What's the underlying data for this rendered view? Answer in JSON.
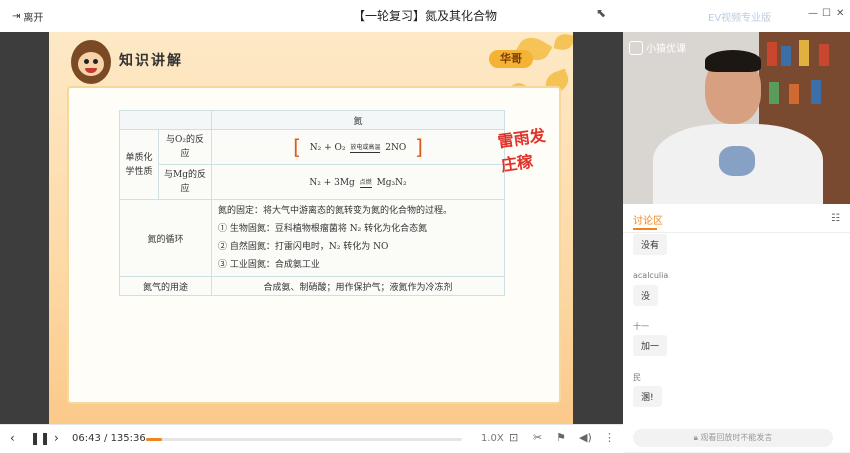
{
  "top_bar": {
    "leave_label": "离开",
    "title": "【一轮复习】氮及其化合物",
    "watermark": "EV视频专业版"
  },
  "slide": {
    "header_title": "知识讲解",
    "teacher_tag": "华哥",
    "table": {
      "header": "氮",
      "row1_label": "单质化学性质",
      "row1_sub1": "与O₂的反应",
      "row1_eq1": {
        "left": "N₂ + O₂",
        "cond": "放电或高温",
        "right": "2NO"
      },
      "row1_sub2": "与Mg的反应",
      "row1_eq2": {
        "left": "N₂ + 3Mg",
        "cond": "点燃",
        "right": "Mg₃N₂"
      },
      "row2_label": "氮的循环",
      "row2_lines": [
        "氮的固定：将大气中游离态的氮转变为氮的化合物的过程。",
        "① 生物固氮：豆科植物根瘤菌将 N₂ 转化为化合态氮",
        "② 自然固氮：打雷闪电时，N₂ 转化为 NO",
        "③ 工业固氮：合成氨工业"
      ],
      "row3_label": "氮气的用途",
      "row3_value": "合成氨、制硝酸；用作保护气；液氮作为冷冻剂"
    },
    "handwriting": "雷雨发庄稼"
  },
  "controls": {
    "time_current": "06:43",
    "time_sep": " / ",
    "time_total": "135:36",
    "progress": 0.05,
    "speed": "1.0X"
  },
  "video": {
    "brand": "小猿优课"
  },
  "chat": {
    "tab_label": "讨论区",
    "messages": [
      {
        "user": "",
        "text": "没有"
      },
      {
        "user": "acalculia",
        "text": "没"
      },
      {
        "user": "十一",
        "text": "加一"
      },
      {
        "user": "民",
        "text": "溷!"
      }
    ],
    "input_placeholder": "观看回放时不能发言"
  },
  "colors": {
    "accent": "#f0851f",
    "slide_bg": "#fde9c6",
    "handwriting": "#e0342a"
  }
}
